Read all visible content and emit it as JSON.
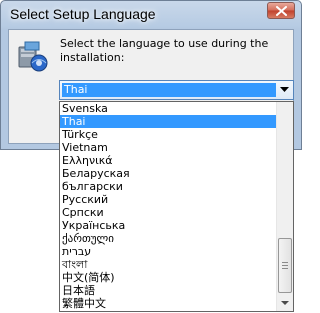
{
  "window": {
    "title": "Select Setup Language",
    "prompt": "Select the language to use during the installation:"
  },
  "icons": {
    "close": "close-icon",
    "setup": "setup-icon",
    "dropdown": "chevron-down-icon"
  },
  "combo": {
    "selected": "Thai"
  },
  "list": {
    "items": [
      "Svenska",
      "Thai",
      "Türkçe",
      "Vietnam",
      "Ελληνικά",
      "Беларуская",
      "български",
      "Русский",
      "Српски",
      "Українська",
      "ქართული",
      "עברית",
      "বাংলা",
      "中文(简体)",
      "日本語",
      "繁體中文"
    ],
    "selected_index": 1
  },
  "colors": {
    "selection": "#3399ff",
    "title_bar": "#b9cde5",
    "close_button": "#c7503c"
  }
}
